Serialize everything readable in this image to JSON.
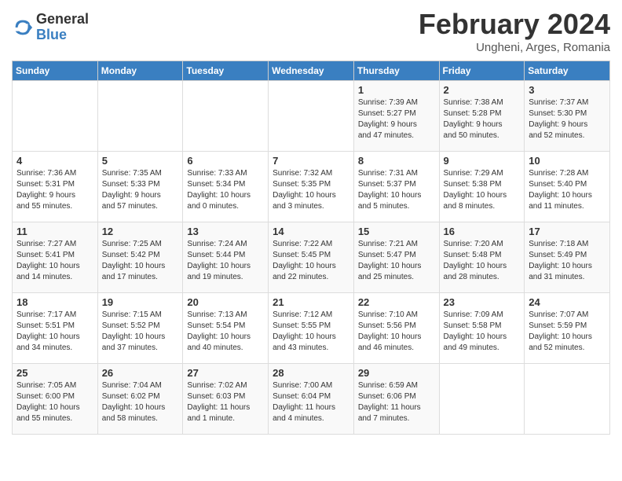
{
  "logo": {
    "general": "General",
    "blue": "Blue"
  },
  "title": "February 2024",
  "subtitle": "Ungheni, Arges, Romania",
  "days_header": [
    "Sunday",
    "Monday",
    "Tuesday",
    "Wednesday",
    "Thursday",
    "Friday",
    "Saturday"
  ],
  "weeks": [
    [
      {
        "day": "",
        "info": ""
      },
      {
        "day": "",
        "info": ""
      },
      {
        "day": "",
        "info": ""
      },
      {
        "day": "",
        "info": ""
      },
      {
        "day": "1",
        "info": "Sunrise: 7:39 AM\nSunset: 5:27 PM\nDaylight: 9 hours\nand 47 minutes."
      },
      {
        "day": "2",
        "info": "Sunrise: 7:38 AM\nSunset: 5:28 PM\nDaylight: 9 hours\nand 50 minutes."
      },
      {
        "day": "3",
        "info": "Sunrise: 7:37 AM\nSunset: 5:30 PM\nDaylight: 9 hours\nand 52 minutes."
      }
    ],
    [
      {
        "day": "4",
        "info": "Sunrise: 7:36 AM\nSunset: 5:31 PM\nDaylight: 9 hours\nand 55 minutes."
      },
      {
        "day": "5",
        "info": "Sunrise: 7:35 AM\nSunset: 5:33 PM\nDaylight: 9 hours\nand 57 minutes."
      },
      {
        "day": "6",
        "info": "Sunrise: 7:33 AM\nSunset: 5:34 PM\nDaylight: 10 hours\nand 0 minutes."
      },
      {
        "day": "7",
        "info": "Sunrise: 7:32 AM\nSunset: 5:35 PM\nDaylight: 10 hours\nand 3 minutes."
      },
      {
        "day": "8",
        "info": "Sunrise: 7:31 AM\nSunset: 5:37 PM\nDaylight: 10 hours\nand 5 minutes."
      },
      {
        "day": "9",
        "info": "Sunrise: 7:29 AM\nSunset: 5:38 PM\nDaylight: 10 hours\nand 8 minutes."
      },
      {
        "day": "10",
        "info": "Sunrise: 7:28 AM\nSunset: 5:40 PM\nDaylight: 10 hours\nand 11 minutes."
      }
    ],
    [
      {
        "day": "11",
        "info": "Sunrise: 7:27 AM\nSunset: 5:41 PM\nDaylight: 10 hours\nand 14 minutes."
      },
      {
        "day": "12",
        "info": "Sunrise: 7:25 AM\nSunset: 5:42 PM\nDaylight: 10 hours\nand 17 minutes."
      },
      {
        "day": "13",
        "info": "Sunrise: 7:24 AM\nSunset: 5:44 PM\nDaylight: 10 hours\nand 19 minutes."
      },
      {
        "day": "14",
        "info": "Sunrise: 7:22 AM\nSunset: 5:45 PM\nDaylight: 10 hours\nand 22 minutes."
      },
      {
        "day": "15",
        "info": "Sunrise: 7:21 AM\nSunset: 5:47 PM\nDaylight: 10 hours\nand 25 minutes."
      },
      {
        "day": "16",
        "info": "Sunrise: 7:20 AM\nSunset: 5:48 PM\nDaylight: 10 hours\nand 28 minutes."
      },
      {
        "day": "17",
        "info": "Sunrise: 7:18 AM\nSunset: 5:49 PM\nDaylight: 10 hours\nand 31 minutes."
      }
    ],
    [
      {
        "day": "18",
        "info": "Sunrise: 7:17 AM\nSunset: 5:51 PM\nDaylight: 10 hours\nand 34 minutes."
      },
      {
        "day": "19",
        "info": "Sunrise: 7:15 AM\nSunset: 5:52 PM\nDaylight: 10 hours\nand 37 minutes."
      },
      {
        "day": "20",
        "info": "Sunrise: 7:13 AM\nSunset: 5:54 PM\nDaylight: 10 hours\nand 40 minutes."
      },
      {
        "day": "21",
        "info": "Sunrise: 7:12 AM\nSunset: 5:55 PM\nDaylight: 10 hours\nand 43 minutes."
      },
      {
        "day": "22",
        "info": "Sunrise: 7:10 AM\nSunset: 5:56 PM\nDaylight: 10 hours\nand 46 minutes."
      },
      {
        "day": "23",
        "info": "Sunrise: 7:09 AM\nSunset: 5:58 PM\nDaylight: 10 hours\nand 49 minutes."
      },
      {
        "day": "24",
        "info": "Sunrise: 7:07 AM\nSunset: 5:59 PM\nDaylight: 10 hours\nand 52 minutes."
      }
    ],
    [
      {
        "day": "25",
        "info": "Sunrise: 7:05 AM\nSunset: 6:00 PM\nDaylight: 10 hours\nand 55 minutes."
      },
      {
        "day": "26",
        "info": "Sunrise: 7:04 AM\nSunset: 6:02 PM\nDaylight: 10 hours\nand 58 minutes."
      },
      {
        "day": "27",
        "info": "Sunrise: 7:02 AM\nSunset: 6:03 PM\nDaylight: 11 hours\nand 1 minute."
      },
      {
        "day": "28",
        "info": "Sunrise: 7:00 AM\nSunset: 6:04 PM\nDaylight: 11 hours\nand 4 minutes."
      },
      {
        "day": "29",
        "info": "Sunrise: 6:59 AM\nSunset: 6:06 PM\nDaylight: 11 hours\nand 7 minutes."
      },
      {
        "day": "",
        "info": ""
      },
      {
        "day": "",
        "info": ""
      }
    ]
  ]
}
